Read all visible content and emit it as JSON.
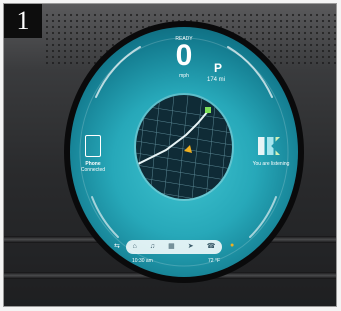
{
  "figure_number": "1",
  "cluster": {
    "gear_top": "READY",
    "speed": "0",
    "speed_unit": "mph",
    "gear": "P",
    "range": "174 mi",
    "phone_title": "Phone",
    "phone_status": "Connected",
    "media_status": "You are listening",
    "left_temp": "67°",
    "right_temp": "72°",
    "bottom_left": "10:30 am",
    "bottom_right": "72 °F"
  },
  "dock_icons": [
    "home-icon",
    "media-icon",
    "apps-icon",
    "nav-icon",
    "phone-icon"
  ],
  "colors": {
    "screen_accent": "#27a8b9",
    "map_background": "#0f2b36",
    "route": "#e8f4f6",
    "destination_marker": "#f0b020",
    "start_marker": "#7de05a"
  }
}
